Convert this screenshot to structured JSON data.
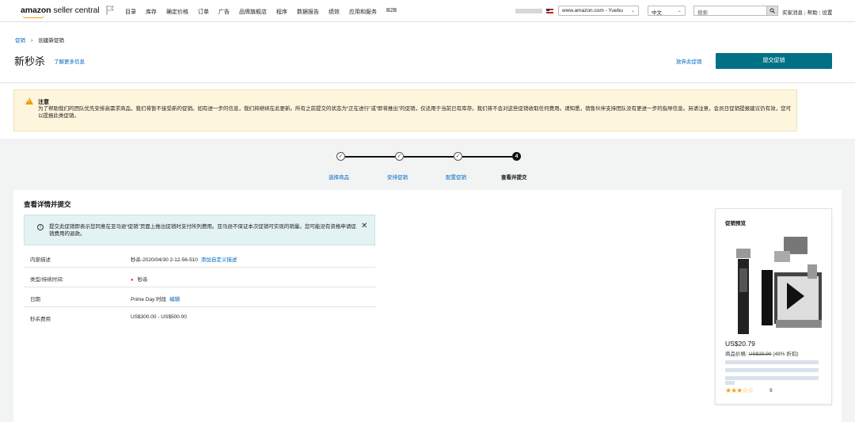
{
  "topnav": {
    "logo_brand": "amazon",
    "logo_sub": " seller central",
    "items": [
      "目录",
      "库存",
      "确定价格",
      "订单",
      "广告",
      "品牌旗舰店",
      "程序",
      "数据报告",
      "绩效",
      "应用和服务",
      "B2B"
    ],
    "marketplace": "www.amazon.com - Yuebu",
    "language": "中文",
    "search_placeholder": "搜索",
    "links": [
      "买家消息",
      "帮助",
      "设置"
    ]
  },
  "breadcrumb": {
    "parent": "促销",
    "current": "创建新促销"
  },
  "header": {
    "title": "新秒杀",
    "learn_more": "了解更多信息",
    "abandon": "放弃此促销",
    "submit": "提交促销"
  },
  "warning": {
    "title": "注意",
    "body": "为了帮助我们的团队优先安排高需求商品，我们将暂不接受新的促销。如有进一步的信息，我们将继续在此更新。所有之前提交的状态为“正在进行”或“即将推出”的促销，仅适用于当前已有库存。我们将不会对这些促销收取任何费用。请知悉，销售伙伴支持团队没有更进一步的指导信息。另请注意，会员日促销提报建议仍有效，您可以提报此类促销。"
  },
  "stepper": {
    "steps": [
      {
        "label": "选择商品",
        "status": "done",
        "mark": "✓"
      },
      {
        "label": "安排促销",
        "status": "done",
        "mark": "✓"
      },
      {
        "label": "配置促销",
        "status": "done",
        "mark": "✓"
      },
      {
        "label": "查看并提交",
        "status": "current",
        "mark": "4"
      }
    ]
  },
  "review": {
    "title": "查看详情并提交",
    "info": "提交此促销即表示您同意在亚马逊“促销”页面上推出促销时支付所列费用。亚马逊不保证本次促销可实现的销量。您可能没有资格申请促销费用的退款。",
    "rows": [
      {
        "label": "内部描述",
        "value": "秒杀-2020/04/30 2-12-56-510",
        "link": "添加自定义描述"
      },
      {
        "label": "类型/持续时间:",
        "value": "秒杀",
        "link": ""
      },
      {
        "label": "日期",
        "value": "Prime Day 时段",
        "link": "编辑"
      },
      {
        "label": "秒杀费用",
        "value": "US$300.00 - US$500.00",
        "link": ""
      }
    ]
  },
  "preview": {
    "title": "促销预览",
    "price": "US$20.79",
    "list_price_label": "商品价格:",
    "list_price": "US$39.99",
    "discount": "(48% 折扣)",
    "stars": "★★★☆☆",
    "rating": 3.5,
    "review_count": "9"
  },
  "colors": {
    "accent": "#007185",
    "link": "#0066c0",
    "warning_bg": "#fdf5dc",
    "info_bg": "#e3f2f2",
    "star": "#f0a41a"
  }
}
